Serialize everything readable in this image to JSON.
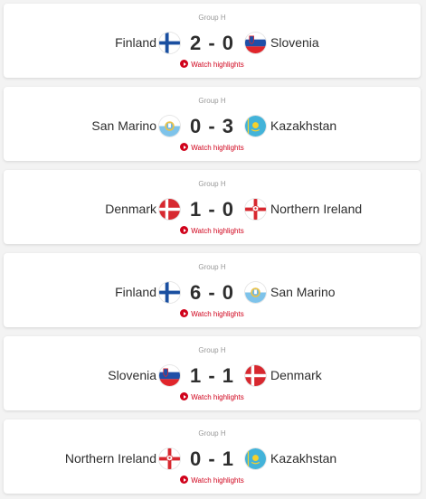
{
  "matches": [
    {
      "group": "Group H",
      "home": "Finland",
      "home_flag": "finland-flag-icon",
      "score": "2 - 0",
      "away": "Slovenia",
      "away_flag": "slovenia-flag-icon",
      "watch": "Watch highlights"
    },
    {
      "group": "Group H",
      "home": "San Marino",
      "home_flag": "san-marino-flag-icon",
      "score": "0 - 3",
      "away": "Kazakhstan",
      "away_flag": "kazakhstan-flag-icon",
      "watch": "Watch highlights"
    },
    {
      "group": "Group H",
      "home": "Denmark",
      "home_flag": "denmark-flag-icon",
      "score": "1 - 0",
      "away": "Northern Ireland",
      "away_flag": "northern-ireland-flag-icon",
      "watch": "Watch highlights"
    },
    {
      "group": "Group H",
      "home": "Finland",
      "home_flag": "finland-flag-icon",
      "score": "6 - 0",
      "away": "San Marino",
      "away_flag": "san-marino-flag-icon",
      "watch": "Watch highlights"
    },
    {
      "group": "Group H",
      "home": "Slovenia",
      "home_flag": "slovenia-flag-icon",
      "score": "1 - 1",
      "away": "Denmark",
      "away_flag": "denmark-flag-icon",
      "watch": "Watch highlights"
    },
    {
      "group": "Group H",
      "home": "Northern Ireland",
      "home_flag": "northern-ireland-flag-icon",
      "score": "0 - 1",
      "away": "Kazakhstan",
      "away_flag": "kazakhstan-flag-icon",
      "watch": "Watch highlights"
    }
  ],
  "colors": {
    "accent": "#d0021b",
    "text": "#2e2e2e",
    "muted": "#9a9a9a",
    "background": "#f3f3f3"
  }
}
